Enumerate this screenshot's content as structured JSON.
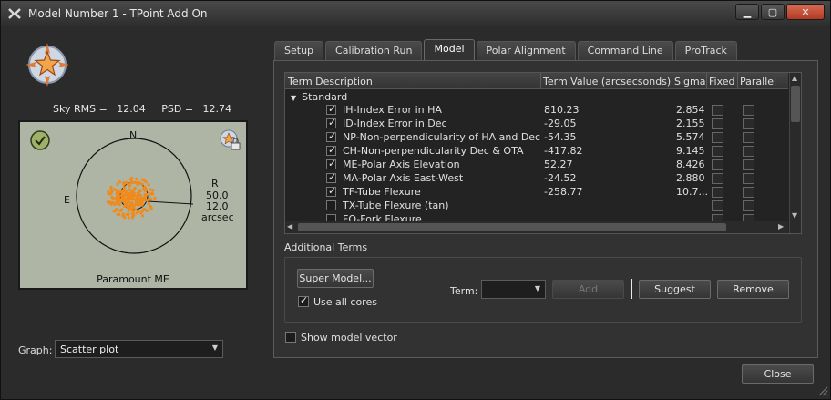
{
  "window": {
    "title": "Model Number 1 - TPoint Add On",
    "min_icon": "minimize-icon",
    "max_icon": "maximize-icon",
    "close_icon": "close-icon"
  },
  "stats": {
    "text": "Sky RMS =   12.04     PSD =   12.74"
  },
  "plot": {
    "north": "N",
    "east": "E",
    "r_label": "R",
    "r_value": "50.0",
    "r_value2": "12.0",
    "r_unit": "arcsec",
    "caption": "Paramount ME",
    "colors": {
      "points": "#f08a1a",
      "background": "#aeb5a4"
    }
  },
  "graph": {
    "label": "Graph:",
    "value": "Scatter plot"
  },
  "tabs": [
    {
      "label": "Setup"
    },
    {
      "label": "Calibration Run"
    },
    {
      "label": "Model"
    },
    {
      "label": "Polar Alignment"
    },
    {
      "label": "Command Line"
    },
    {
      "label": "ProTrack"
    }
  ],
  "table": {
    "columns": [
      "Term Description",
      "Term Value (arcsecsonds)",
      "Sigma",
      "Fixed",
      "Parallel"
    ],
    "group": "Standard",
    "rows": [
      {
        "desc": "IH-Index Error in HA",
        "value": "810.23",
        "sigma": "2.854",
        "checked": true
      },
      {
        "desc": "ID-Index Error in Dec",
        "value": "-29.05",
        "sigma": "2.155",
        "checked": true
      },
      {
        "desc": "NP-Non-perpendicularity of HA and Dec",
        "value": "-54.35",
        "sigma": "5.574",
        "checked": true
      },
      {
        "desc": "CH-Non-perpendicularity Dec & OTA",
        "value": "-417.82",
        "sigma": "9.145",
        "checked": true
      },
      {
        "desc": "ME-Polar Axis Elevation",
        "value": "52.27",
        "sigma": "8.426",
        "checked": true
      },
      {
        "desc": "MA-Polar Axis East-West",
        "value": "-24.52",
        "sigma": "2.880",
        "checked": true
      },
      {
        "desc": "TF-Tube Flexure",
        "value": "-258.77",
        "sigma": "10.7...",
        "checked": true
      },
      {
        "desc": "TX-Tube Flexure (tan)",
        "value": "",
        "sigma": "",
        "checked": false
      },
      {
        "desc": "FO-Fork Flexure",
        "value": "",
        "sigma": "",
        "checked": false
      }
    ]
  },
  "additional": {
    "label": "Additional Terms",
    "super_model": "Super Model...",
    "use_all_cores": "Use all cores",
    "term_label": "Term:",
    "add": "Add",
    "suggest": "Suggest",
    "remove": "Remove"
  },
  "show_model_vector": "Show model vector",
  "close": "Close"
}
